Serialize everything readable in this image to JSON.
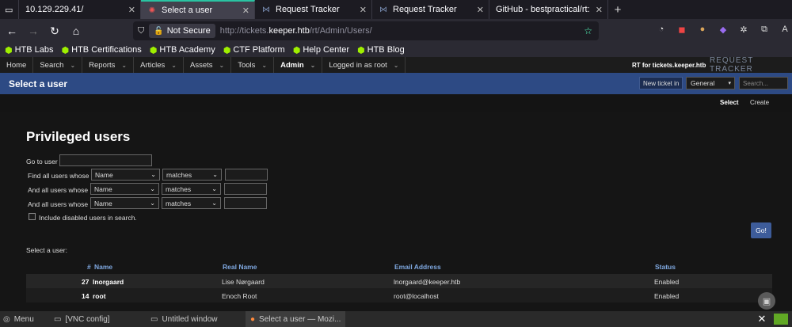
{
  "tabs": [
    {
      "title": "10.129.229.41/",
      "icon": "window-icon"
    },
    {
      "title": "Select a user",
      "icon": "rt-icon"
    },
    {
      "title": "Request Tracker",
      "icon": "rt-icon"
    },
    {
      "title": "Request Tracker",
      "icon": "rt-icon"
    },
    {
      "title": "GitHub - bestpractical/rt:",
      "icon": "github-icon"
    }
  ],
  "navbar": {
    "security": "Not Secure",
    "url_prefix": "http://tickets.",
    "url_host": "keeper.htb",
    "url_path": "/rt/Admin/Users/"
  },
  "bookmarks": [
    "HTB Labs",
    "HTB Certifications",
    "HTB Academy",
    "CTF Platform",
    "Help Center",
    "HTB Blog"
  ],
  "rt_menu": {
    "items": [
      "Home",
      "Search",
      "Reports",
      "Articles",
      "Assets",
      "Tools",
      "Admin",
      "Logged in as root"
    ],
    "site_title": "RT for tickets.keeper.htb",
    "logo_text": "REQUEST TRACKER"
  },
  "header": {
    "title": "Select a user",
    "new_ticket": "New ticket in",
    "queue": "General",
    "search_placeholder": "Search..."
  },
  "subnav": {
    "select": "Select",
    "create": "Create"
  },
  "page": {
    "title": "Privileged users",
    "go_to_user": "Go to user",
    "find_label": "Find all users whose",
    "and_label": "And all users whose",
    "field_value": "Name",
    "op_value": "matches",
    "include_disabled": "Include disabled users in search.",
    "go_button": "Go!",
    "select_a_user": "Select a user:"
  },
  "table": {
    "columns": [
      "#",
      "Name",
      "Real Name",
      "Email Address",
      "Status"
    ],
    "rows": [
      {
        "id": "27",
        "name": "lnorgaard",
        "real_name": "Lise Nørgaard",
        "email": "lnorgaard@keeper.htb",
        "status": "Enabled"
      },
      {
        "id": "14",
        "name": "root",
        "real_name": "Enoch Root",
        "email": "root@localhost",
        "status": "Enabled"
      }
    ]
  },
  "taskbar": {
    "menu": "Menu",
    "vnc": "[VNC config]",
    "untitled": "Untitled window",
    "firefox": "Select a user — Mozi..."
  },
  "colors": {
    "accent": "#2ac3a2",
    "header": "#2d4a84",
    "link": "#7fa8e0",
    "htb": "#9fef00"
  }
}
